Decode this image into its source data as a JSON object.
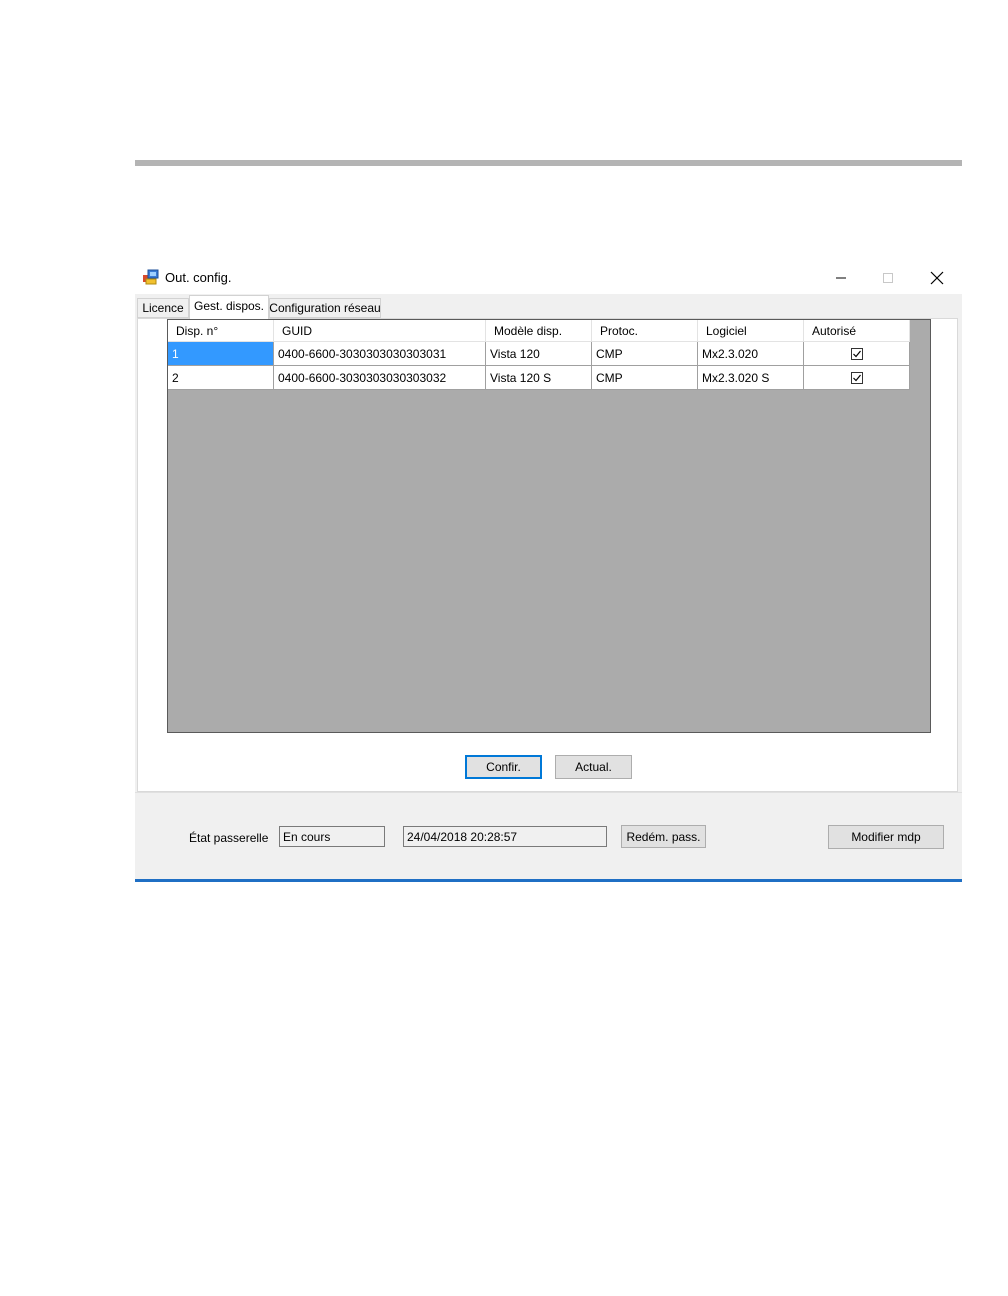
{
  "window": {
    "title": "Out. config.",
    "icon": "app-config-icon"
  },
  "tabs": [
    {
      "label": "Licence",
      "active": false
    },
    {
      "label": "Gest. dispos.",
      "active": true
    },
    {
      "label": "Configuration réseau",
      "active": false
    }
  ],
  "grid": {
    "columns": [
      "Disp. n°",
      "GUID",
      "Modèle disp.",
      "Protoc.",
      "Logiciel",
      "Autorisé"
    ],
    "rows": [
      {
        "disp": "1",
        "guid": "0400-6600-3030303030303031",
        "model": "Vista 120",
        "protocol": "CMP",
        "software": "Mx2.3.020",
        "authorized": true
      },
      {
        "disp": "2",
        "guid": "0400-6600-3030303030303032",
        "model": "Vista 120 S",
        "protocol": "CMP",
        "software": "Mx2.3.020 S",
        "authorized": true
      }
    ]
  },
  "buttons": {
    "confirm": "Confir.",
    "refresh": "Actual.",
    "restart_gateway": "Redém. pass.",
    "change_password": "Modifier mdp"
  },
  "status": {
    "label": "État passerelle",
    "state": "En cours",
    "timestamp": "24/04/2018 20:28:57"
  },
  "colors": {
    "selection": "#3399ff",
    "accent": "#0078d7",
    "grid_background": "#ababab"
  }
}
